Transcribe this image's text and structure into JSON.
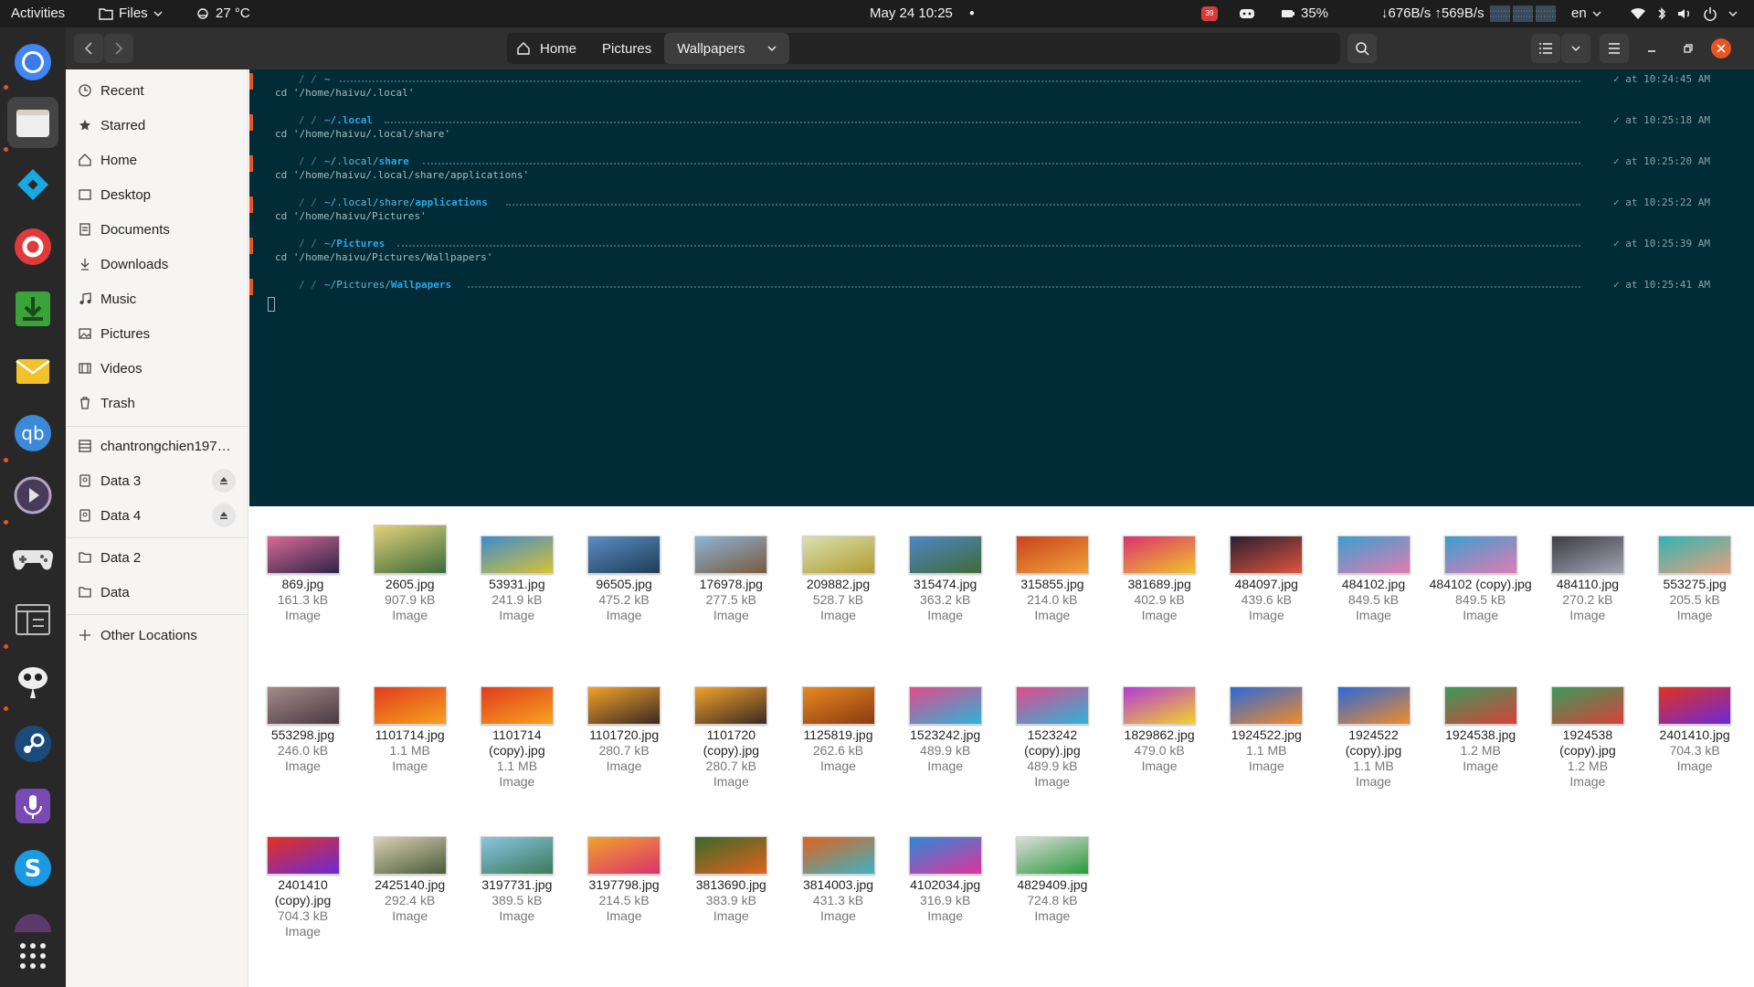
{
  "topbar": {
    "activities": "Activities",
    "app_menu": "Files",
    "weather": "27 °C",
    "datetime": "May 24  10:25",
    "notif_badge": "39",
    "battery": "35%",
    "net_speed": "↓676B/s ↑569B/s",
    "lang": "en"
  },
  "pathbar": {
    "crumbs": [
      "Home",
      "Pictures",
      "Wallpapers"
    ]
  },
  "sidebar": {
    "items": [
      {
        "label": "Recent",
        "icon": "clock-icon"
      },
      {
        "label": "Starred",
        "icon": "star-icon"
      },
      {
        "label": "Home",
        "icon": "home-icon"
      },
      {
        "label": "Desktop",
        "icon": "desktop-icon"
      },
      {
        "label": "Documents",
        "icon": "document-icon"
      },
      {
        "label": "Downloads",
        "icon": "download-icon"
      },
      {
        "label": "Music",
        "icon": "music-icon"
      },
      {
        "label": "Pictures",
        "icon": "pictures-icon"
      },
      {
        "label": "Videos",
        "icon": "video-icon"
      },
      {
        "label": "Trash",
        "icon": "trash-icon"
      }
    ],
    "devices": [
      {
        "label": "chantrongchien1979...",
        "icon": "network-drive-icon"
      },
      {
        "label": "Data 3",
        "icon": "drive-icon"
      },
      {
        "label": "Data 4",
        "icon": "drive-icon"
      }
    ],
    "bookmarks": [
      {
        "label": "Data 2",
        "icon": "folder-icon"
      },
      {
        "label": "Data",
        "icon": "folder-icon"
      }
    ],
    "other": "Other Locations"
  },
  "terminal": {
    "entries": [
      {
        "path_pre": "~",
        "path_bold": "",
        "time": "✓ at 10:24:45 AM",
        "cmd": "cd '/home/haivu/.local'"
      },
      {
        "path_pre": "~/",
        "path_bold": ".local",
        "time": "✓ at 10:25:18 AM",
        "cmd": "cd '/home/haivu/.local/share'"
      },
      {
        "path_pre": "~/.local/",
        "path_bold": "share",
        "time": "✓ at 10:25:20 AM",
        "cmd": "cd '/home/haivu/.local/share/applications'"
      },
      {
        "path_pre": "~/.local/share/",
        "path_bold": "applications",
        "time": "✓ at 10:25:22 AM",
        "cmd": "cd '/home/haivu/Pictures'"
      },
      {
        "path_pre": "~/",
        "path_bold": "Pictures",
        "time": "✓ at 10:25:39 AM",
        "cmd": "cd '/home/haivu/Pictures/Wallpapers'"
      },
      {
        "path_pre": "~/Pictures/",
        "path_bold": "Wallpapers",
        "time": "✓ at 10:25:41 AM",
        "cmd": ""
      }
    ]
  },
  "files": [
    {
      "name": "869.jpg",
      "size": "161.3 kB",
      "type": "Image",
      "colors": [
        "#d96a95",
        "#2d2448"
      ]
    },
    {
      "name": "2605.jpg",
      "size": "907.9 kB",
      "type": "Image",
      "colors": [
        "#e2d07a",
        "#3a6b3a"
      ]
    },
    {
      "name": "53931.jpg",
      "size": "241.9 kB",
      "type": "Image",
      "colors": [
        "#3b8bd1",
        "#d9c232"
      ]
    },
    {
      "name": "96505.jpg",
      "size": "475.2 kB",
      "type": "Image",
      "colors": [
        "#5d8dc4",
        "#1c3d56"
      ]
    },
    {
      "name": "176978.jpg",
      "size": "277.5 kB",
      "type": "Image",
      "colors": [
        "#8cb4d9",
        "#7a5a3a"
      ]
    },
    {
      "name": "209882.jpg",
      "size": "528.7 kB",
      "type": "Image",
      "colors": [
        "#d8e0b2",
        "#b29c2f"
      ]
    },
    {
      "name": "315474.jpg",
      "size": "363.2 kB",
      "type": "Image",
      "colors": [
        "#4f86c7",
        "#3f6b36"
      ]
    },
    {
      "name": "315855.jpg",
      "size": "214.0 kB",
      "type": "Image",
      "colors": [
        "#c9421d",
        "#f2a13a"
      ]
    },
    {
      "name": "381689.jpg",
      "size": "402.9 kB",
      "type": "Image",
      "colors": [
        "#d9326f",
        "#f2c22a"
      ]
    },
    {
      "name": "484097.jpg",
      "size": "439.6 kB",
      "type": "Image",
      "colors": [
        "#2a1f33",
        "#e0543a"
      ]
    },
    {
      "name": "484102.jpg",
      "size": "849.5 kB",
      "type": "Image",
      "colors": [
        "#3b9fd1",
        "#e27bb2"
      ]
    },
    {
      "name": "484102 (copy).jpg",
      "size": "849.5 kB",
      "type": "Image",
      "colors": [
        "#3b9fd1",
        "#e27bb2"
      ]
    },
    {
      "name": "484110.jpg",
      "size": "270.2 kB",
      "type": "Image",
      "colors": [
        "#3d3d45",
        "#a3a3b2"
      ]
    },
    {
      "name": "553275.jpg",
      "size": "205.5 kB",
      "type": "Image",
      "colors": [
        "#30b4b4",
        "#e9a07a"
      ]
    },
    {
      "name": "553298.jpg",
      "size": "246.0 kB",
      "type": "Image",
      "colors": [
        "#a48a8a",
        "#4a3a42"
      ]
    },
    {
      "name": "1101714.jpg",
      "size": "1.1 MB",
      "type": "Image",
      "colors": [
        "#e33b1d",
        "#f5a31f"
      ]
    },
    {
      "name": "1101714 (copy).jpg",
      "size": "1.1 MB",
      "type": "Image",
      "colors": [
        "#e33b1d",
        "#f5a31f"
      ]
    },
    {
      "name": "1101720.jpg",
      "size": "280.7 kB",
      "type": "Image",
      "colors": [
        "#f2a12a",
        "#3a2a22"
      ]
    },
    {
      "name": "1101720 (copy).jpg",
      "size": "280.7 kB",
      "type": "Image",
      "colors": [
        "#f2a12a",
        "#3a2a22"
      ]
    },
    {
      "name": "1125819.jpg",
      "size": "262.6 kB",
      "type": "Image",
      "colors": [
        "#e8891f",
        "#8a3a12"
      ]
    },
    {
      "name": "1523242.jpg",
      "size": "489.9 kB",
      "type": "Image",
      "colors": [
        "#e24a8a",
        "#2ab4d9"
      ]
    },
    {
      "name": "1523242 (copy).jpg",
      "size": "489.9 kB",
      "type": "Image",
      "colors": [
        "#e24a8a",
        "#2ab4d9"
      ]
    },
    {
      "name": "1829862.jpg",
      "size": "479.0 kB",
      "type": "Image",
      "colors": [
        "#b43ad9",
        "#f2d22a"
      ]
    },
    {
      "name": "1924522.jpg",
      "size": "1.1 MB",
      "type": "Image",
      "colors": [
        "#2a6ad9",
        "#f28a2a"
      ]
    },
    {
      "name": "1924522 (copy).jpg",
      "size": "1.1 MB",
      "type": "Image",
      "colors": [
        "#2a6ad9",
        "#f28a2a"
      ]
    },
    {
      "name": "1924538.jpg",
      "size": "1.2 MB",
      "type": "Image",
      "colors": [
        "#3a9a5a",
        "#d9413a"
      ]
    },
    {
      "name": "1924538 (copy).jpg",
      "size": "1.2 MB",
      "type": "Image",
      "colors": [
        "#3a9a5a",
        "#d9413a"
      ]
    },
    {
      "name": "2401410.jpg",
      "size": "704.3 kB",
      "type": "Image",
      "colors": [
        "#e2321d",
        "#6a2ad9"
      ]
    },
    {
      "name": "2401410 (copy).jpg",
      "size": "704.3 kB",
      "type": "Image",
      "colors": [
        "#e2321d",
        "#6a2ad9"
      ]
    },
    {
      "name": "2425140.jpg",
      "size": "292.4 kB",
      "type": "Image",
      "colors": [
        "#d9d0b2",
        "#4a5a3a"
      ]
    },
    {
      "name": "3197731.jpg",
      "size": "389.5 kB",
      "type": "Image",
      "colors": [
        "#8ac4e2",
        "#3a7a5a"
      ]
    },
    {
      "name": "3197798.jpg",
      "size": "214.5 kB",
      "type": "Image",
      "colors": [
        "#f2a12a",
        "#d9326f"
      ]
    },
    {
      "name": "3813690.jpg",
      "size": "383.9 kB",
      "type": "Image",
      "colors": [
        "#3a6a2a",
        "#e2621d"
      ]
    },
    {
      "name": "3814003.jpg",
      "size": "431.3 kB",
      "type": "Image",
      "colors": [
        "#e2621d",
        "#3ab4c4"
      ]
    },
    {
      "name": "4102034.jpg",
      "size": "316.9 kB",
      "type": "Image",
      "colors": [
        "#2a8ad9",
        "#e2329a"
      ]
    },
    {
      "name": "4829409.jpg",
      "size": "724.8 kB",
      "type": "Image",
      "colors": [
        "#dcdcdc",
        "#2a9a3a"
      ]
    }
  ]
}
